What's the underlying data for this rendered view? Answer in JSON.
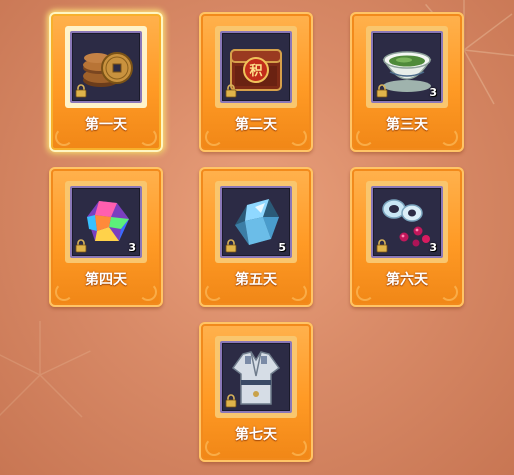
{
  "days": [
    {
      "label": "第一天",
      "item": "copper-coins",
      "quantity": "",
      "selected": true
    },
    {
      "label": "第二天",
      "item": "treasure-chest",
      "chest_text": "积",
      "quantity": "",
      "selected": false
    },
    {
      "label": "第三天",
      "item": "tea-cup",
      "quantity": "3",
      "selected": false
    },
    {
      "label": "第四天",
      "item": "rainbow-gem",
      "quantity": "3",
      "selected": false
    },
    {
      "label": "第五天",
      "item": "blue-crystal",
      "quantity": "5",
      "selected": false
    },
    {
      "label": "第六天",
      "item": "bead-set",
      "quantity": "3",
      "selected": false
    },
    {
      "label": "第七天",
      "item": "robe-costume",
      "quantity": "",
      "selected": false
    }
  ],
  "colors": {
    "card_orange": "#ff9a25",
    "slot_border": "#8a77b7",
    "slot_bg": "#2c2b45",
    "label_text": "#ffffff"
  }
}
